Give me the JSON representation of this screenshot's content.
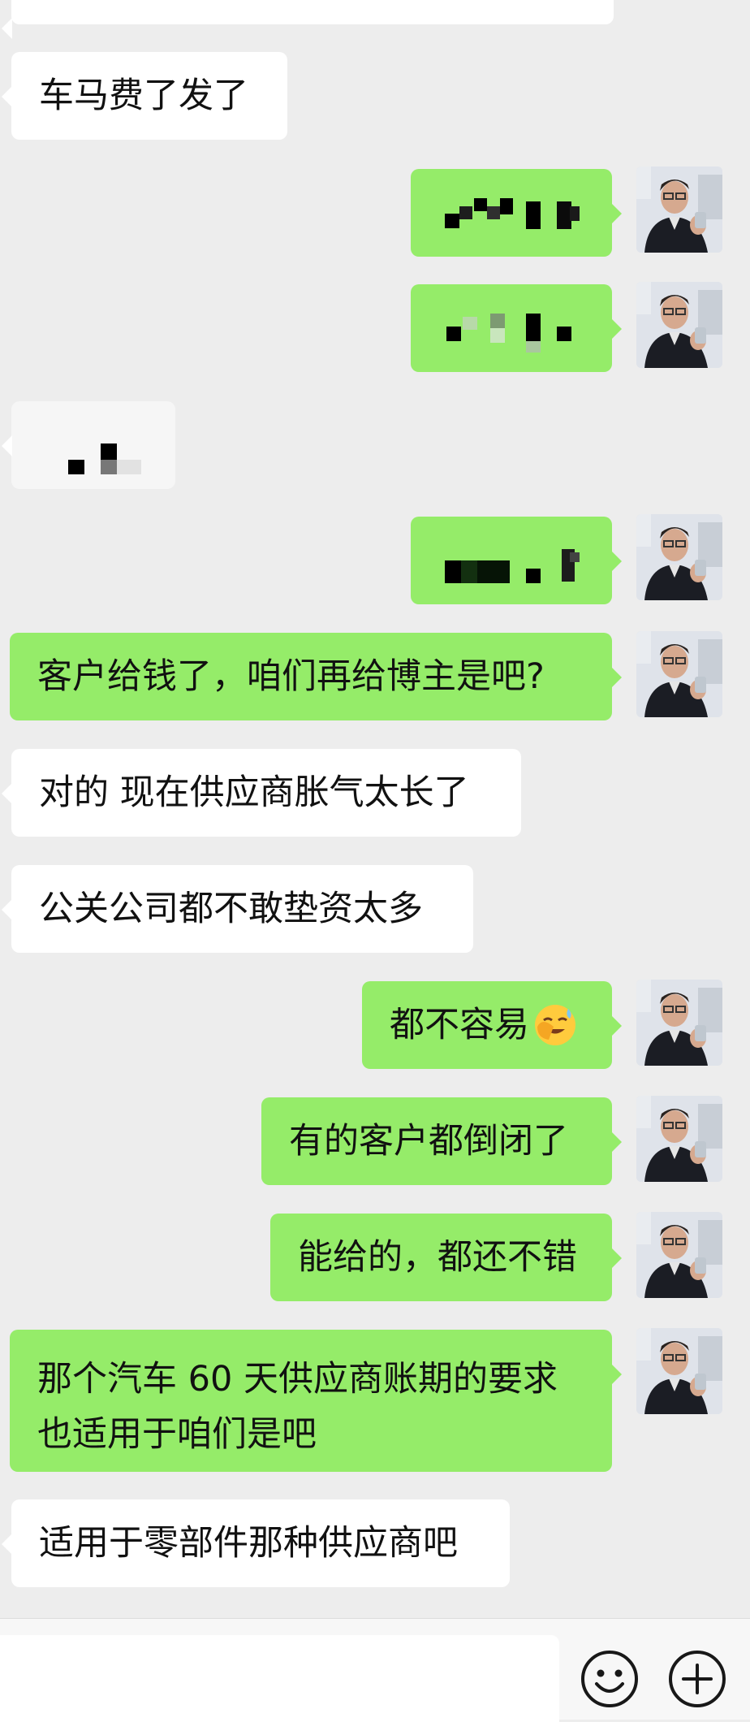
{
  "messages": [
    {
      "id": "m1",
      "side": "left",
      "text": "车马费了发了"
    },
    {
      "id": "m2",
      "side": "right",
      "text": "",
      "redacted": true
    },
    {
      "id": "m3",
      "side": "right",
      "text": "",
      "redacted": true
    },
    {
      "id": "m4",
      "side": "left",
      "text": "",
      "redacted": true
    },
    {
      "id": "m5",
      "side": "right",
      "text": "",
      "redacted": true
    },
    {
      "id": "m6",
      "side": "right",
      "text": "客户给钱了，咱们再给博主是吧?"
    },
    {
      "id": "m7",
      "side": "left",
      "text": "对的 现在供应商胀气太长了"
    },
    {
      "id": "m8",
      "side": "left",
      "text": "公关公司都不敢垫资太多"
    },
    {
      "id": "m9",
      "side": "right",
      "text": "都不容易",
      "emoji": "grinning-sweat-cover-face-emoji"
    },
    {
      "id": "m10",
      "side": "right",
      "text": "有的客户都倒闭了"
    },
    {
      "id": "m11",
      "side": "right",
      "text": "能给的，都还不错"
    },
    {
      "id": "m12",
      "side": "right",
      "lines": [
        "那个汽车 60 天供应商账期的要求",
        "也适用于咱们是吧"
      ]
    },
    {
      "id": "m13",
      "side": "left",
      "text": "适用于零部件那种供应商吧"
    }
  ],
  "input_bar": {
    "icons": [
      "emoji-icon",
      "plus-icon"
    ]
  },
  "colors": {
    "background": "#ededed",
    "incoming_bubble": "#ffffff",
    "outgoing_bubble": "#95ec69",
    "text": "#111111"
  }
}
